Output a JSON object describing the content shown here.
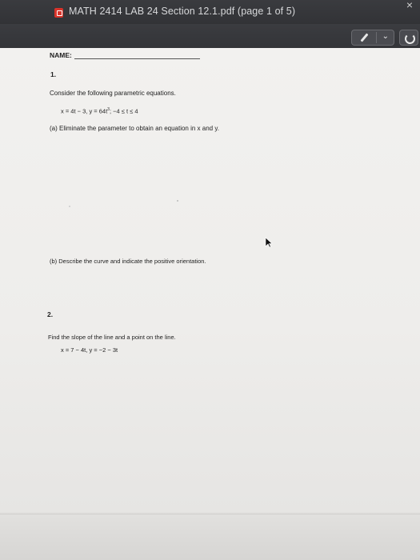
{
  "window": {
    "title": "MATH 2414 LAB 24 Section 12.1.pdf (page 1 of 5)",
    "file_icon": "pdf-icon",
    "control_icon": "close-icon"
  },
  "toolbar": {
    "markup_icon": "pen-icon",
    "markup_chevron": "⌄",
    "rotate_icon": "rotate-icon"
  },
  "document": {
    "name_label": "NAME:",
    "q1": {
      "number": "1.",
      "prompt": "Consider the following parametric equations.",
      "eq_main": "x = 4t − 3,  y = 64t",
      "eq_exp": "3",
      "eq_range": ";   −4 ≤ t ≤ 4",
      "part_a": "(a) Eliminate the parameter to obtain an equation in x and y.",
      "part_b": "(b) Describe the curve and indicate the positive orientation."
    },
    "q2": {
      "number": "2.",
      "prompt": "Find the slope of the line and a point on the line.",
      "equations": "x = 7 − 4t, y = −2 − 3t"
    }
  },
  "colors": {
    "titlebar": "#2c2d30",
    "page": "#f2f1ef",
    "pdf_icon": "#d9342b"
  }
}
